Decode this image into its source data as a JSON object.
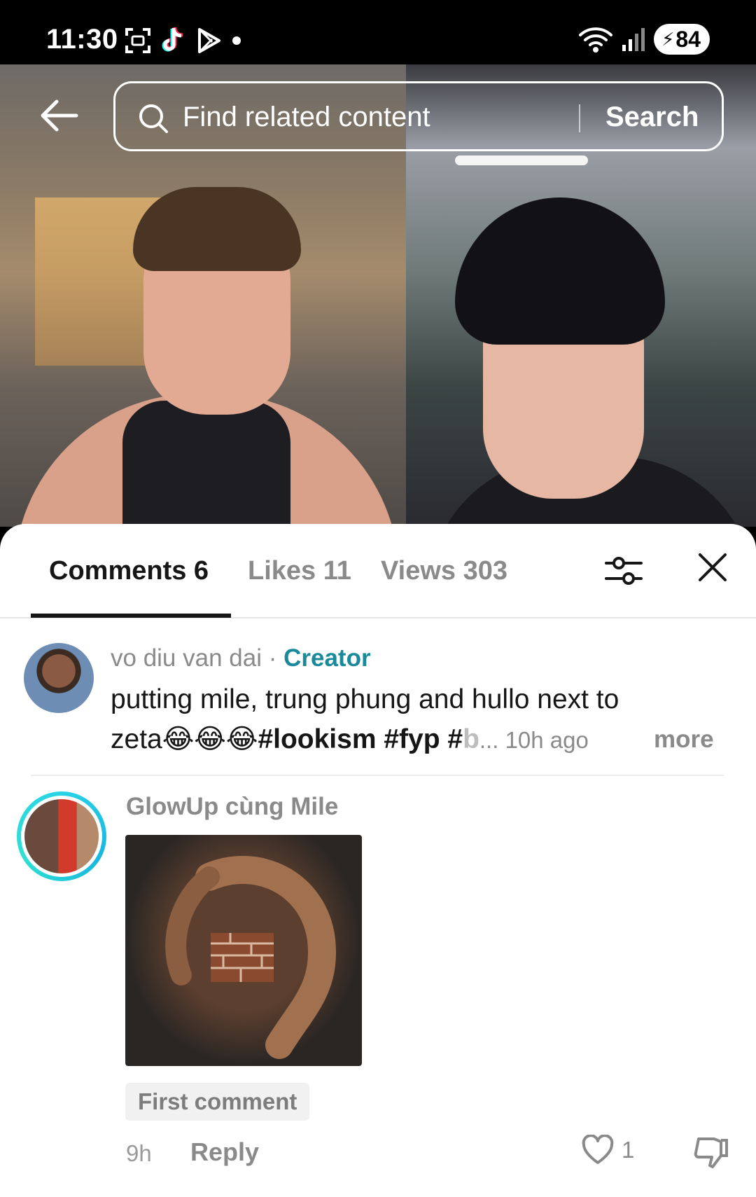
{
  "status_bar": {
    "time": "11:30",
    "battery": "84",
    "left_icons": [
      "screen-capture-icon",
      "tiktok-icon",
      "play-store-icon",
      "dot-icon"
    ],
    "right_icons": [
      "wifi-icon",
      "signal-icon",
      "battery-icon"
    ]
  },
  "search": {
    "placeholder": "Find related content",
    "button_label": "Search"
  },
  "tabs": [
    {
      "label": "Comments 6",
      "active": true
    },
    {
      "label": "Likes 11",
      "active": false
    },
    {
      "label": "Views 303",
      "active": false
    }
  ],
  "comments": [
    {
      "author": "vo diu van dai",
      "separator": " · ",
      "badge": "Creator",
      "text_line1": "putting mile, trung phung and hullo next to",
      "text_line2_plain": "zeta",
      "emojis": "😂😂😂",
      "hashtags": "#lookism #fyp #",
      "faded": "b",
      "ellipsis": "... ",
      "time": "10h ago",
      "more_label": "more"
    },
    {
      "author": "GlowUp cùng Mile",
      "badge": "First comment",
      "time": "9h",
      "reply_label": "Reply",
      "like_count": "1"
    }
  ],
  "colors": {
    "creator_accent": "#1a8a9a",
    "story_ring": "#29d3e6",
    "text_primary": "#161616",
    "text_secondary": "#8a8a8a"
  }
}
